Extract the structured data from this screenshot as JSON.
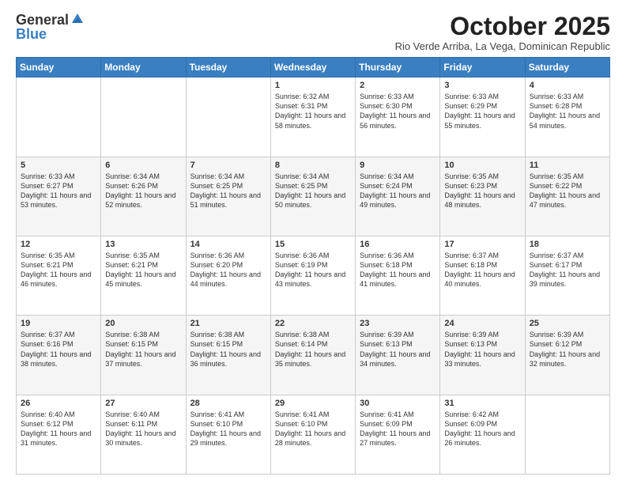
{
  "logo": {
    "general": "General",
    "blue": "Blue"
  },
  "title": "October 2025",
  "subtitle": "Rio Verde Arriba, La Vega, Dominican Republic",
  "weekdays": [
    "Sunday",
    "Monday",
    "Tuesday",
    "Wednesday",
    "Thursday",
    "Friday",
    "Saturday"
  ],
  "weeks": [
    [
      {
        "day": "",
        "sunrise": "",
        "sunset": "",
        "daylight": "",
        "empty": true
      },
      {
        "day": "",
        "sunrise": "",
        "sunset": "",
        "daylight": "",
        "empty": true
      },
      {
        "day": "",
        "sunrise": "",
        "sunset": "",
        "daylight": "",
        "empty": true
      },
      {
        "day": "1",
        "sunrise": "Sunrise: 6:32 AM",
        "sunset": "Sunset: 6:31 PM",
        "daylight": "Daylight: 11 hours and 58 minutes."
      },
      {
        "day": "2",
        "sunrise": "Sunrise: 6:33 AM",
        "sunset": "Sunset: 6:30 PM",
        "daylight": "Daylight: 11 hours and 56 minutes."
      },
      {
        "day": "3",
        "sunrise": "Sunrise: 6:33 AM",
        "sunset": "Sunset: 6:29 PM",
        "daylight": "Daylight: 11 hours and 55 minutes."
      },
      {
        "day": "4",
        "sunrise": "Sunrise: 6:33 AM",
        "sunset": "Sunset: 6:28 PM",
        "daylight": "Daylight: 11 hours and 54 minutes."
      }
    ],
    [
      {
        "day": "5",
        "sunrise": "Sunrise: 6:33 AM",
        "sunset": "Sunset: 6:27 PM",
        "daylight": "Daylight: 11 hours and 53 minutes."
      },
      {
        "day": "6",
        "sunrise": "Sunrise: 6:34 AM",
        "sunset": "Sunset: 6:26 PM",
        "daylight": "Daylight: 11 hours and 52 minutes."
      },
      {
        "day": "7",
        "sunrise": "Sunrise: 6:34 AM",
        "sunset": "Sunset: 6:25 PM",
        "daylight": "Daylight: 11 hours and 51 minutes."
      },
      {
        "day": "8",
        "sunrise": "Sunrise: 6:34 AM",
        "sunset": "Sunset: 6:25 PM",
        "daylight": "Daylight: 11 hours and 50 minutes."
      },
      {
        "day": "9",
        "sunrise": "Sunrise: 6:34 AM",
        "sunset": "Sunset: 6:24 PM",
        "daylight": "Daylight: 11 hours and 49 minutes."
      },
      {
        "day": "10",
        "sunrise": "Sunrise: 6:35 AM",
        "sunset": "Sunset: 6:23 PM",
        "daylight": "Daylight: 11 hours and 48 minutes."
      },
      {
        "day": "11",
        "sunrise": "Sunrise: 6:35 AM",
        "sunset": "Sunset: 6:22 PM",
        "daylight": "Daylight: 11 hours and 47 minutes."
      }
    ],
    [
      {
        "day": "12",
        "sunrise": "Sunrise: 6:35 AM",
        "sunset": "Sunset: 6:21 PM",
        "daylight": "Daylight: 11 hours and 46 minutes."
      },
      {
        "day": "13",
        "sunrise": "Sunrise: 6:35 AM",
        "sunset": "Sunset: 6:21 PM",
        "daylight": "Daylight: 11 hours and 45 minutes."
      },
      {
        "day": "14",
        "sunrise": "Sunrise: 6:36 AM",
        "sunset": "Sunset: 6:20 PM",
        "daylight": "Daylight: 11 hours and 44 minutes."
      },
      {
        "day": "15",
        "sunrise": "Sunrise: 6:36 AM",
        "sunset": "Sunset: 6:19 PM",
        "daylight": "Daylight: 11 hours and 43 minutes."
      },
      {
        "day": "16",
        "sunrise": "Sunrise: 6:36 AM",
        "sunset": "Sunset: 6:18 PM",
        "daylight": "Daylight: 11 hours and 41 minutes."
      },
      {
        "day": "17",
        "sunrise": "Sunrise: 6:37 AM",
        "sunset": "Sunset: 6:18 PM",
        "daylight": "Daylight: 11 hours and 40 minutes."
      },
      {
        "day": "18",
        "sunrise": "Sunrise: 6:37 AM",
        "sunset": "Sunset: 6:17 PM",
        "daylight": "Daylight: 11 hours and 39 minutes."
      }
    ],
    [
      {
        "day": "19",
        "sunrise": "Sunrise: 6:37 AM",
        "sunset": "Sunset: 6:16 PM",
        "daylight": "Daylight: 11 hours and 38 minutes."
      },
      {
        "day": "20",
        "sunrise": "Sunrise: 6:38 AM",
        "sunset": "Sunset: 6:15 PM",
        "daylight": "Daylight: 11 hours and 37 minutes."
      },
      {
        "day": "21",
        "sunrise": "Sunrise: 6:38 AM",
        "sunset": "Sunset: 6:15 PM",
        "daylight": "Daylight: 11 hours and 36 minutes."
      },
      {
        "day": "22",
        "sunrise": "Sunrise: 6:38 AM",
        "sunset": "Sunset: 6:14 PM",
        "daylight": "Daylight: 11 hours and 35 minutes."
      },
      {
        "day": "23",
        "sunrise": "Sunrise: 6:39 AM",
        "sunset": "Sunset: 6:13 PM",
        "daylight": "Daylight: 11 hours and 34 minutes."
      },
      {
        "day": "24",
        "sunrise": "Sunrise: 6:39 AM",
        "sunset": "Sunset: 6:13 PM",
        "daylight": "Daylight: 11 hours and 33 minutes."
      },
      {
        "day": "25",
        "sunrise": "Sunrise: 6:39 AM",
        "sunset": "Sunset: 6:12 PM",
        "daylight": "Daylight: 11 hours and 32 minutes."
      }
    ],
    [
      {
        "day": "26",
        "sunrise": "Sunrise: 6:40 AM",
        "sunset": "Sunset: 6:12 PM",
        "daylight": "Daylight: 11 hours and 31 minutes."
      },
      {
        "day": "27",
        "sunrise": "Sunrise: 6:40 AM",
        "sunset": "Sunset: 6:11 PM",
        "daylight": "Daylight: 11 hours and 30 minutes."
      },
      {
        "day": "28",
        "sunrise": "Sunrise: 6:41 AM",
        "sunset": "Sunset: 6:10 PM",
        "daylight": "Daylight: 11 hours and 29 minutes."
      },
      {
        "day": "29",
        "sunrise": "Sunrise: 6:41 AM",
        "sunset": "Sunset: 6:10 PM",
        "daylight": "Daylight: 11 hours and 28 minutes."
      },
      {
        "day": "30",
        "sunrise": "Sunrise: 6:41 AM",
        "sunset": "Sunset: 6:09 PM",
        "daylight": "Daylight: 11 hours and 27 minutes."
      },
      {
        "day": "31",
        "sunrise": "Sunrise: 6:42 AM",
        "sunset": "Sunset: 6:09 PM",
        "daylight": "Daylight: 11 hours and 26 minutes."
      },
      {
        "day": "",
        "sunrise": "",
        "sunset": "",
        "daylight": "",
        "empty": true
      }
    ]
  ]
}
